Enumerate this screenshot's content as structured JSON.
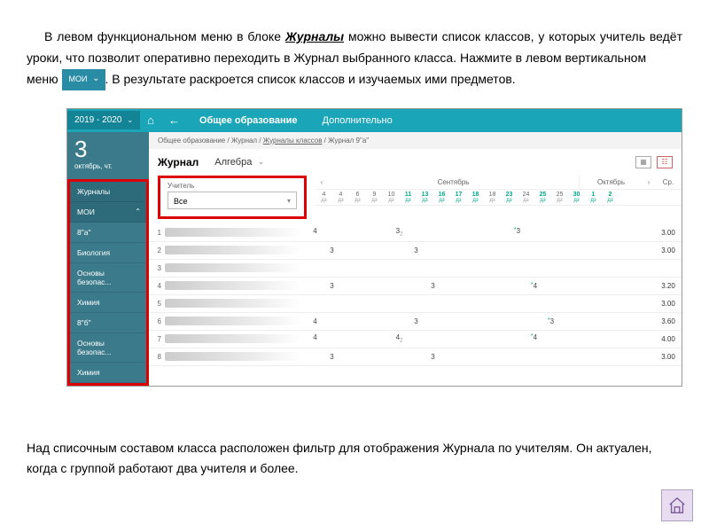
{
  "doc": {
    "p1a": "В левом функциональном меню в блоке ",
    "p1b": "Журналы",
    "p1c": " можно вывести список классов, у которых учитель ведёт уроки, что позволит оперативно переходить в Журнал выбранного класса. Нажмите в левом вертикальном",
    "p2a": "меню ",
    "inline_btn": "МОИ",
    "p2b": ". В результате раскроется список классов и изучаемых ими предметов.",
    "p3": "Над списочным составом класса расположен фильтр для отображения Журнала по учителям. Он актуален, когда с группой работают два учителя и более."
  },
  "top": {
    "year": "2019 - 2020",
    "tab1": "Общее образование",
    "tab2": "Дополнительно"
  },
  "date": {
    "day": "3",
    "sub": "октябрь, чт."
  },
  "sidebar": {
    "head": "Журналы",
    "moi": "МОИ",
    "items": [
      "8\"а\"",
      "Биология",
      "Основы безопас...",
      "Химия",
      "8\"б\"",
      "Основы безопас...",
      "Химия"
    ]
  },
  "crumb": {
    "a": "Общее образование",
    "b": "Журнал",
    "c": "Журналы классов",
    "d": "Журнал 9\"а\""
  },
  "journal": {
    "label": "Журнал",
    "subject": "Алгебра"
  },
  "teacher": {
    "label": "Учитель",
    "value": "Все"
  },
  "months": {
    "m1": "Сентябрь",
    "m2": "Октябрь",
    "sr": "Ср."
  },
  "days": [
    {
      "d": "4",
      "z": "дз"
    },
    {
      "d": "4",
      "z": "дз"
    },
    {
      "d": "6",
      "z": "дз"
    },
    {
      "d": "9",
      "z": "дз"
    },
    {
      "d": "10",
      "z": "дз"
    },
    {
      "d": "11",
      "z": "дз",
      "hl": true
    },
    {
      "d": "13",
      "z": "дз",
      "hl": true
    },
    {
      "d": "16",
      "z": "дз",
      "hl": true
    },
    {
      "d": "17",
      "z": "дз",
      "hl": true
    },
    {
      "d": "18",
      "z": "дз",
      "hl": true
    },
    {
      "d": "18",
      "z": "дз"
    },
    {
      "d": "23",
      "z": "дз",
      "hl": true
    },
    {
      "d": "24",
      "z": "дз"
    },
    {
      "d": "25",
      "z": "дз",
      "hl": true
    },
    {
      "d": "25",
      "z": "дз"
    },
    {
      "d": "30",
      "z": "дз",
      "hl": true
    },
    {
      "d": "1",
      "z": "дз",
      "hl": true
    },
    {
      "d": "2",
      "z": "дз",
      "hl": true
    }
  ],
  "rows": [
    {
      "n": "1",
      "cells": {
        "0": "4",
        "5": "3",
        "5s": "2",
        "12": "3",
        "12star": true
      },
      "sr": "3.00"
    },
    {
      "n": "2",
      "cells": {
        "1": "3",
        "6": "3"
      },
      "sr": "3.00"
    },
    {
      "n": "3",
      "cells": {},
      "sr": ""
    },
    {
      "n": "4",
      "cells": {
        "1": "3",
        "7": "3",
        "13": "4",
        "13star": true
      },
      "sr": "3.20"
    },
    {
      "n": "5",
      "cells": {},
      "sr": "3.00"
    },
    {
      "n": "6",
      "cells": {
        "0": "4",
        "6": "3",
        "14": "3",
        "14star": true
      },
      "sr": "3.60"
    },
    {
      "n": "7",
      "cells": {
        "0": "4",
        "5": "4",
        "5s": "2",
        "13": "4",
        "13star": true
      },
      "sr": "4.00"
    },
    {
      "n": "8",
      "cells": {
        "1": "3",
        "7": "3"
      },
      "sr": "3.00"
    }
  ]
}
